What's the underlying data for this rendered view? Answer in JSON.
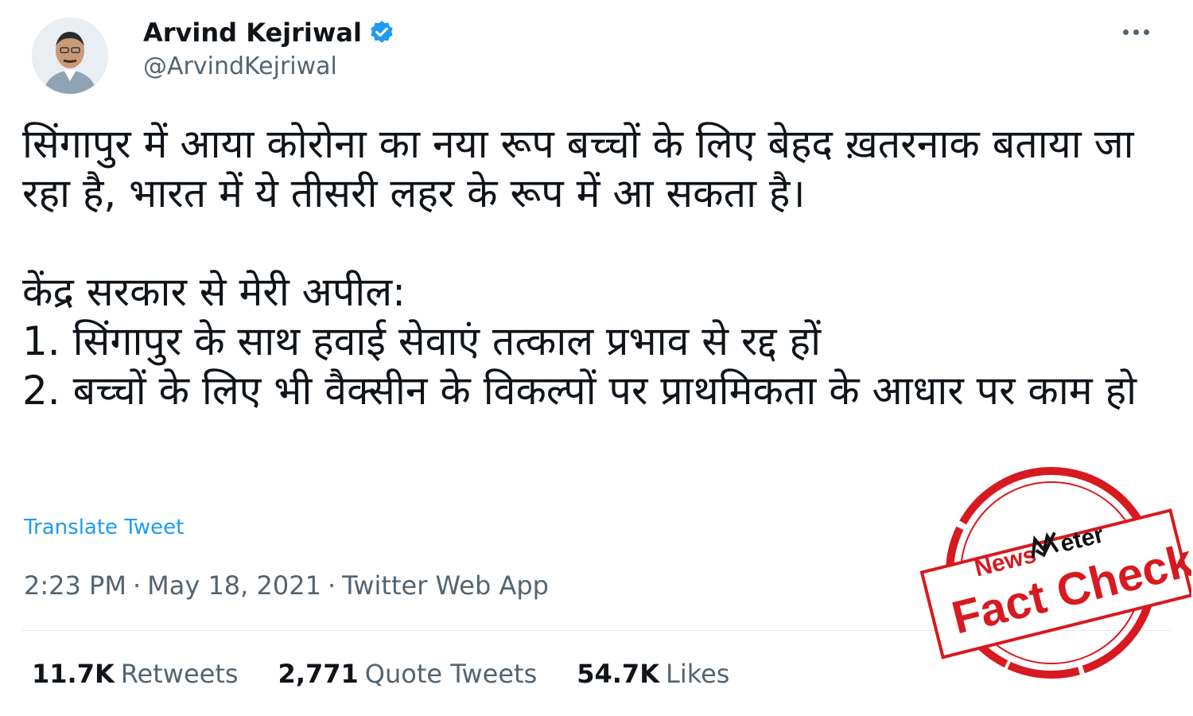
{
  "author": {
    "display_name": "Arvind Kejriwal",
    "handle": "@ArvindKejriwal",
    "verified": true
  },
  "tweet": {
    "paragraphs": [
      "सिंगापुर में आया कोरोना का नया रूप बच्चों के लिए बेहद ख़तरनाक बताया जा रहा है, भारत में ये तीसरी लहर के रूप में आ सकता है।",
      "केंद्र सरकार से मेरी अपील:",
      "1. सिंगापुर के साथ हवाई सेवाएं तत्काल प्रभाव से रद्द हों",
      "2. बच्चों के लिए भी वैक्सीन के विकल्पों पर प्राथमिकता के आधार पर काम हो"
    ],
    "translate_label": "Translate Tweet",
    "time": "2:23 PM",
    "date": "May 18, 2021",
    "source": "Twitter Web App",
    "separator": "·"
  },
  "stats": {
    "retweets": {
      "value": "11.7K",
      "label": "Retweets"
    },
    "quote_tweets": {
      "value": "2,771",
      "label": "Quote Tweets"
    },
    "likes": {
      "value": "54.7K",
      "label": "Likes"
    }
  },
  "stamp": {
    "brand_news": "News",
    "brand_meter": "eter",
    "text": "Fact Check",
    "color": "#d71920"
  },
  "colors": {
    "link": "#1d9bf0",
    "secondary_text": "#536471",
    "primary_text": "#0f1419",
    "verified_badge": "#1d9bf0"
  },
  "icons": {
    "verified": "verified-badge-icon",
    "more": "more-options-icon"
  }
}
